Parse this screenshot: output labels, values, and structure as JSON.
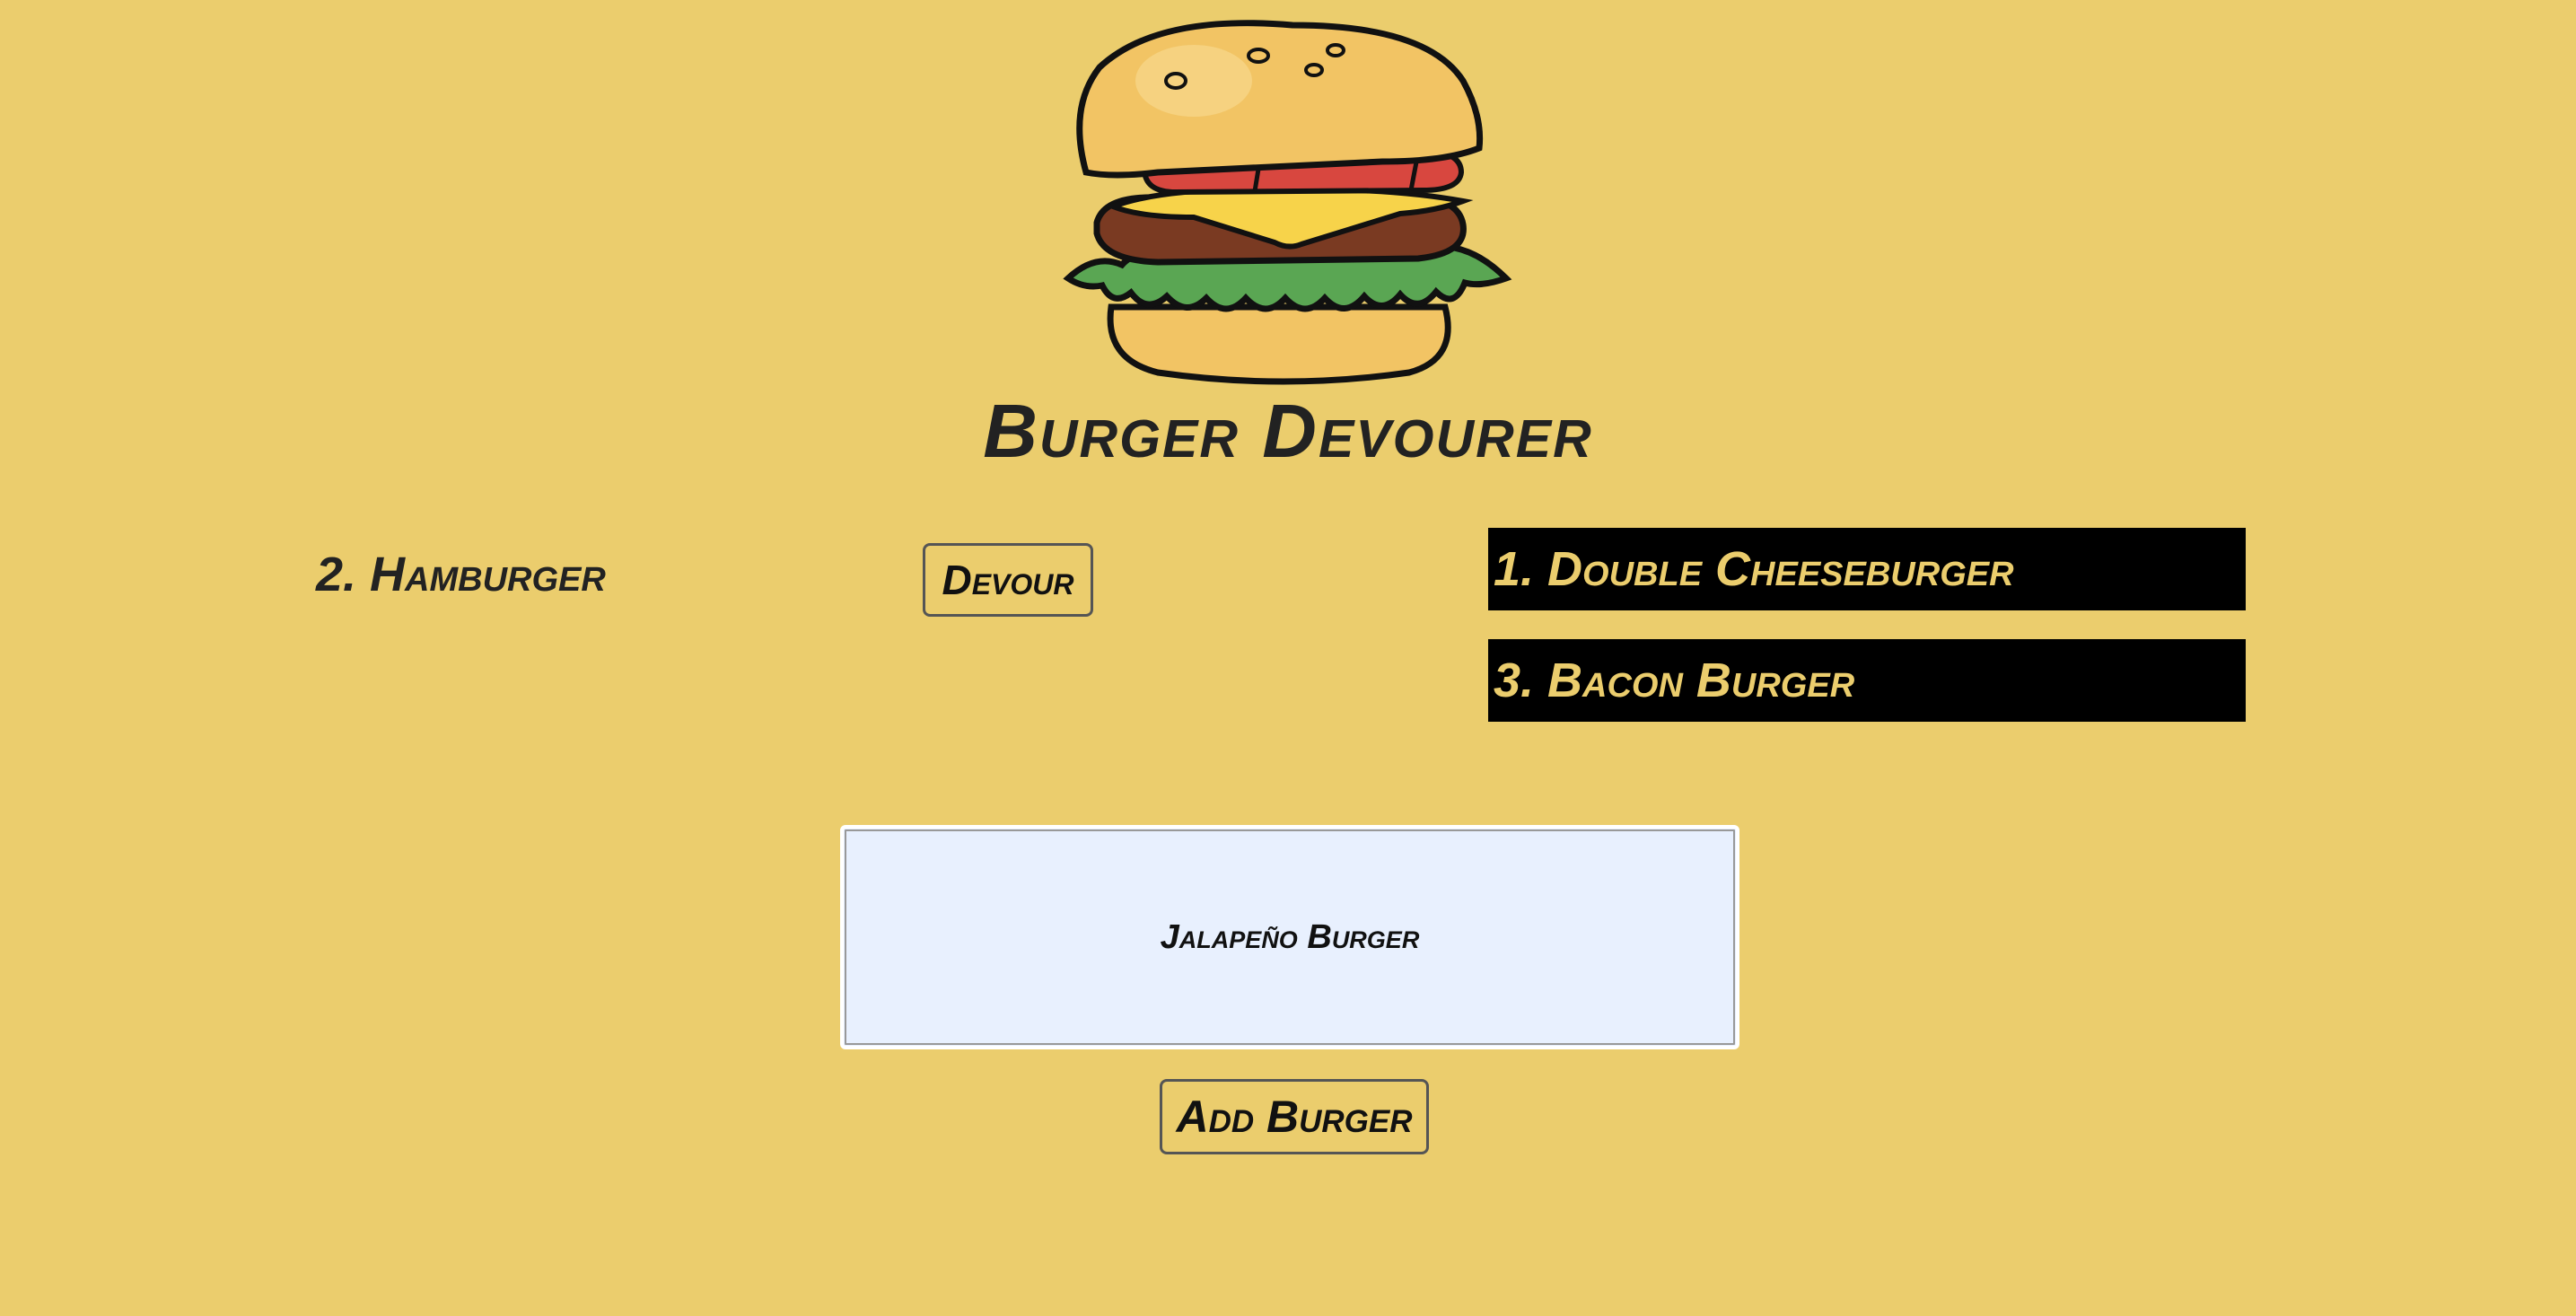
{
  "app": {
    "title": "Burger Devourer",
    "logo_icon": "burger-logo-icon"
  },
  "uneaten": {
    "items": [
      {
        "label": "2. Hamburger",
        "action_label": "Devour"
      }
    ]
  },
  "devoured": {
    "items": [
      {
        "label": "1. Double Cheeseburger"
      },
      {
        "label": "3. Bacon Burger"
      }
    ]
  },
  "form": {
    "input_value": "Jalapeño Burger",
    "submit_label": "Add Burger"
  },
  "colors": {
    "background": "#ebcd6d",
    "devoured_bg": "#000000",
    "devoured_text": "#ebcd6d",
    "input_bg": "#e8f0fe",
    "text": "#222222"
  }
}
